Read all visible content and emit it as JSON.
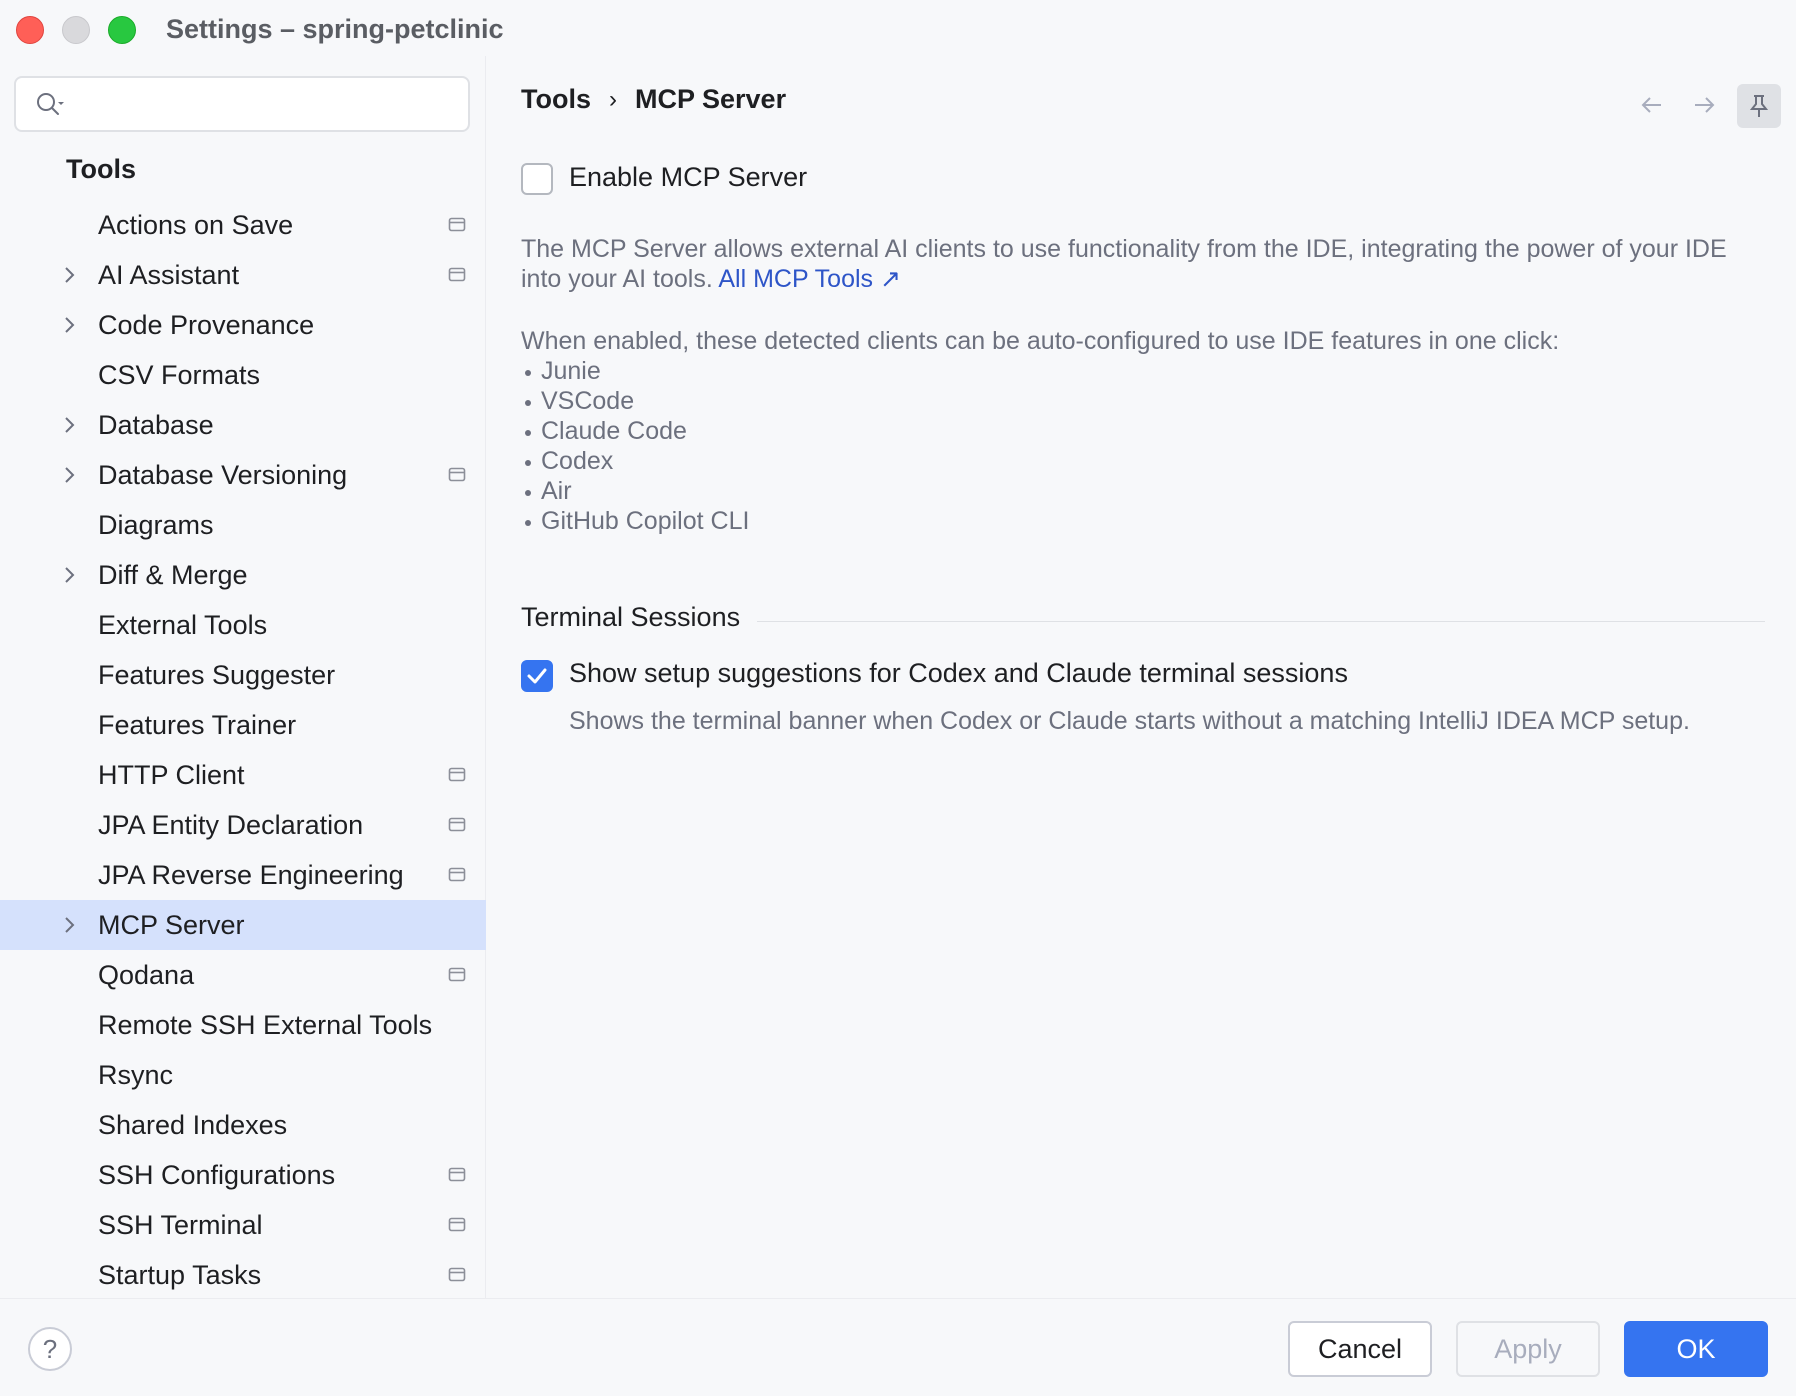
{
  "window": {
    "title": "Settings – spring-petclinic"
  },
  "search": {
    "placeholder": "",
    "value": ""
  },
  "sidebar": {
    "header": "Tools",
    "items": [
      {
        "label": "Actions on Save",
        "expandable": false,
        "project_icon": true
      },
      {
        "label": "AI Assistant",
        "expandable": true,
        "project_icon": true
      },
      {
        "label": "Code Provenance",
        "expandable": true,
        "project_icon": false
      },
      {
        "label": "CSV Formats",
        "expandable": false,
        "project_icon": false
      },
      {
        "label": "Database",
        "expandable": true,
        "project_icon": false
      },
      {
        "label": "Database Versioning",
        "expandable": true,
        "project_icon": true
      },
      {
        "label": "Diagrams",
        "expandable": false,
        "project_icon": false
      },
      {
        "label": "Diff & Merge",
        "expandable": true,
        "project_icon": false
      },
      {
        "label": "External Tools",
        "expandable": false,
        "project_icon": false
      },
      {
        "label": "Features Suggester",
        "expandable": false,
        "project_icon": false
      },
      {
        "label": "Features Trainer",
        "expandable": false,
        "project_icon": false
      },
      {
        "label": "HTTP Client",
        "expandable": false,
        "project_icon": true
      },
      {
        "label": "JPA Entity Declaration",
        "expandable": false,
        "project_icon": true
      },
      {
        "label": "JPA Reverse Engineering",
        "expandable": false,
        "project_icon": true
      },
      {
        "label": "MCP Server",
        "expandable": true,
        "project_icon": false,
        "selected": true
      },
      {
        "label": "Qodana",
        "expandable": false,
        "project_icon": true
      },
      {
        "label": "Remote SSH External Tools",
        "expandable": false,
        "project_icon": false
      },
      {
        "label": "Rsync",
        "expandable": false,
        "project_icon": false
      },
      {
        "label": "Shared Indexes",
        "expandable": false,
        "project_icon": false
      },
      {
        "label": "SSH Configurations",
        "expandable": false,
        "project_icon": true
      },
      {
        "label": "SSH Terminal",
        "expandable": false,
        "project_icon": true
      },
      {
        "label": "Startup Tasks",
        "expandable": false,
        "project_icon": true
      }
    ]
  },
  "breadcrumb": {
    "parent": "Tools",
    "separator": "›",
    "current": "MCP Server"
  },
  "enable": {
    "label": "Enable MCP Server",
    "checked": false
  },
  "description": {
    "text": "The MCP Server allows external AI clients to use functionality from the IDE, integrating the power of your IDE into your AI tools.",
    "link": "All MCP Tools ↗"
  },
  "clients": {
    "intro": "When enabled, these detected clients can be auto-configured to use IDE features in one click:",
    "list": [
      "Junie",
      "VSCode",
      "Claude Code",
      "Codex",
      "Air",
      "GitHub Copilot CLI"
    ]
  },
  "terminal_sessions": {
    "title": "Terminal Sessions",
    "option_label": "Show setup suggestions for Codex and Claude terminal sessions",
    "option_checked": true,
    "hint": "Shows the terminal banner when Codex or Claude starts without a matching IntelliJ IDEA MCP setup."
  },
  "footer": {
    "help": "?",
    "cancel": "Cancel",
    "apply": "Apply",
    "ok": "OK"
  },
  "colors": {
    "accent": "#3574f0",
    "link": "#2e55c8",
    "selection": "#d5e1fc",
    "muted_text": "#6c707e"
  }
}
